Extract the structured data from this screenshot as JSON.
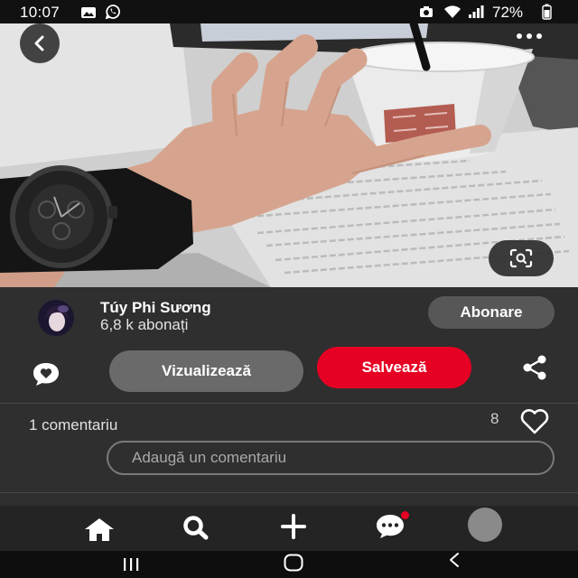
{
  "status_bar": {
    "time": "10:07",
    "battery": "72%",
    "icons": [
      "gallery-icon",
      "whatsapp-icon",
      "camera-icon",
      "wifi-icon",
      "signal-icon",
      "battery-icon"
    ]
  },
  "pin_overlay": {
    "back_icon": "chevron-left-icon",
    "more_icon": "more-horizontal-icon",
    "lens_icon": "visual-search-icon"
  },
  "creator": {
    "name": "Túy Phi Sương",
    "followers": "6,8 k abonați",
    "follow_label": "Abonare"
  },
  "actions": {
    "comment_icon": "comment-heart-icon",
    "view_label": "Vizualizează",
    "save_label": "Salvează",
    "share_icon": "share-icon"
  },
  "comments": {
    "count_label": "1 comentariu",
    "reaction_count": "8",
    "reaction_icon": "heart-outline-icon",
    "input_placeholder": "Adaugă un comentariu"
  },
  "bottom_nav": {
    "items": [
      {
        "icon": "home-icon"
      },
      {
        "icon": "search-icon"
      },
      {
        "icon": "plus-icon"
      },
      {
        "icon": "chat-icon",
        "badge": true
      },
      {
        "icon": "profile-avatar"
      }
    ]
  },
  "system_nav": {
    "items": [
      "recents-icon",
      "home-button-icon",
      "back-icon"
    ]
  },
  "colors": {
    "save_button": "#e60023",
    "notification_badge": "#e60023",
    "panel_background": "#2f2f2f"
  }
}
